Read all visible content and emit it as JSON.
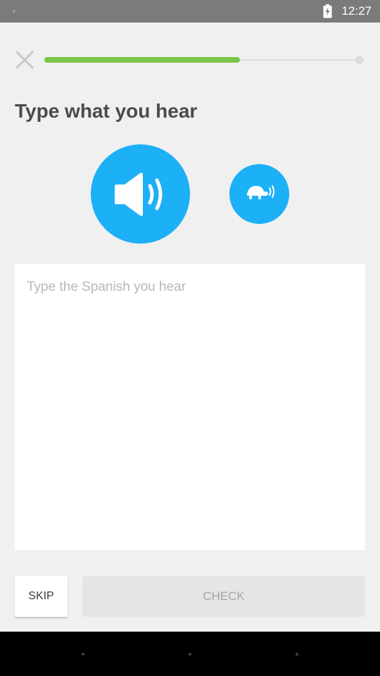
{
  "status_bar": {
    "time": "12:27",
    "icons": [
      "notification-dot-icon",
      "battery-charging-icon"
    ]
  },
  "header": {
    "close_icon": "close-icon",
    "progress_fraction": 0.62
  },
  "prompt": {
    "title": "Type what you hear"
  },
  "audio": {
    "play_icon": "speaker-icon",
    "slow_icon": "turtle-icon",
    "accent_color": "#1cb0f6"
  },
  "answer": {
    "placeholder": "Type the Spanish you hear",
    "value": ""
  },
  "footer": {
    "skip_label": "SKIP",
    "check_label": "CHECK"
  },
  "colors": {
    "progress": "#78c547",
    "title": "#4b4b4b",
    "background": "#f0f0f0"
  }
}
